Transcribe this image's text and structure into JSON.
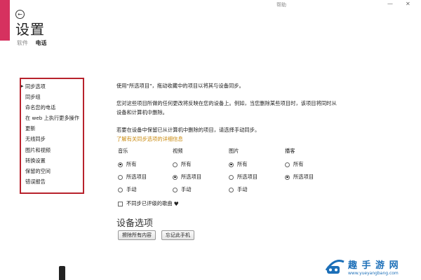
{
  "window": {
    "help": "帮助",
    "minimize": "—",
    "close": "✕"
  },
  "header": {
    "back_icon": "back-arrow-icon",
    "title": "设置",
    "tabs": [
      {
        "label": "软件",
        "active": false
      },
      {
        "label": "电话",
        "active": true
      }
    ]
  },
  "sidebar": {
    "items": [
      {
        "label": "同步选项",
        "selected": true
      },
      {
        "label": "同步组"
      },
      {
        "label": "命名您的电话"
      },
      {
        "label": "在 web 上执行更多操作"
      },
      {
        "label": "更新"
      },
      {
        "label": "无线同步"
      },
      {
        "label": "图片和视频"
      },
      {
        "label": "转换设置"
      },
      {
        "label": "保留的空间"
      },
      {
        "label": "错误报告"
      }
    ],
    "highlight_color": "#b8222c"
  },
  "main": {
    "intro": "使用\"所选项目\"，拖动收藏中的项目以将其与设备同步。",
    "para2_line1": "您对这些项目所做的任何更改将反映在您的设备上。例如，当您删除某些项目时，该项目将同时从",
    "para2_line2": "设备和计算机中删除。",
    "para3": "若要在设备中保留已从计算机中删除的项目，请选择手动同步。",
    "learn_more": "了解有关同步选项的详细信息",
    "columns": [
      {
        "title": "音乐",
        "options": [
          {
            "label": "所有",
            "checked": true
          },
          {
            "label": "所选项目",
            "checked": false
          },
          {
            "label": "手动",
            "checked": false
          }
        ]
      },
      {
        "title": "视频",
        "options": [
          {
            "label": "所有",
            "checked": false
          },
          {
            "label": "所选项目",
            "checked": true
          },
          {
            "label": "手动",
            "checked": false
          }
        ]
      },
      {
        "title": "图片",
        "options": [
          {
            "label": "所有",
            "checked": true
          },
          {
            "label": "所选项目",
            "checked": false
          },
          {
            "label": "手动",
            "checked": false
          }
        ]
      },
      {
        "title": "播客",
        "options": [
          {
            "label": "所有",
            "checked": false
          },
          {
            "label": "所选项目",
            "checked": true
          }
        ]
      }
    ],
    "unrated_checkbox": "不同步已评级的歌曲",
    "heart_icon": "heart-icon",
    "device_section_title": "设备选项",
    "erase_button": "擦除所有内容",
    "forget_button": "忘记此手机"
  },
  "watermark": {
    "brand": "趣 手 游 网",
    "url": "www.yueyangbang.com",
    "color": "#1c6fb8"
  }
}
